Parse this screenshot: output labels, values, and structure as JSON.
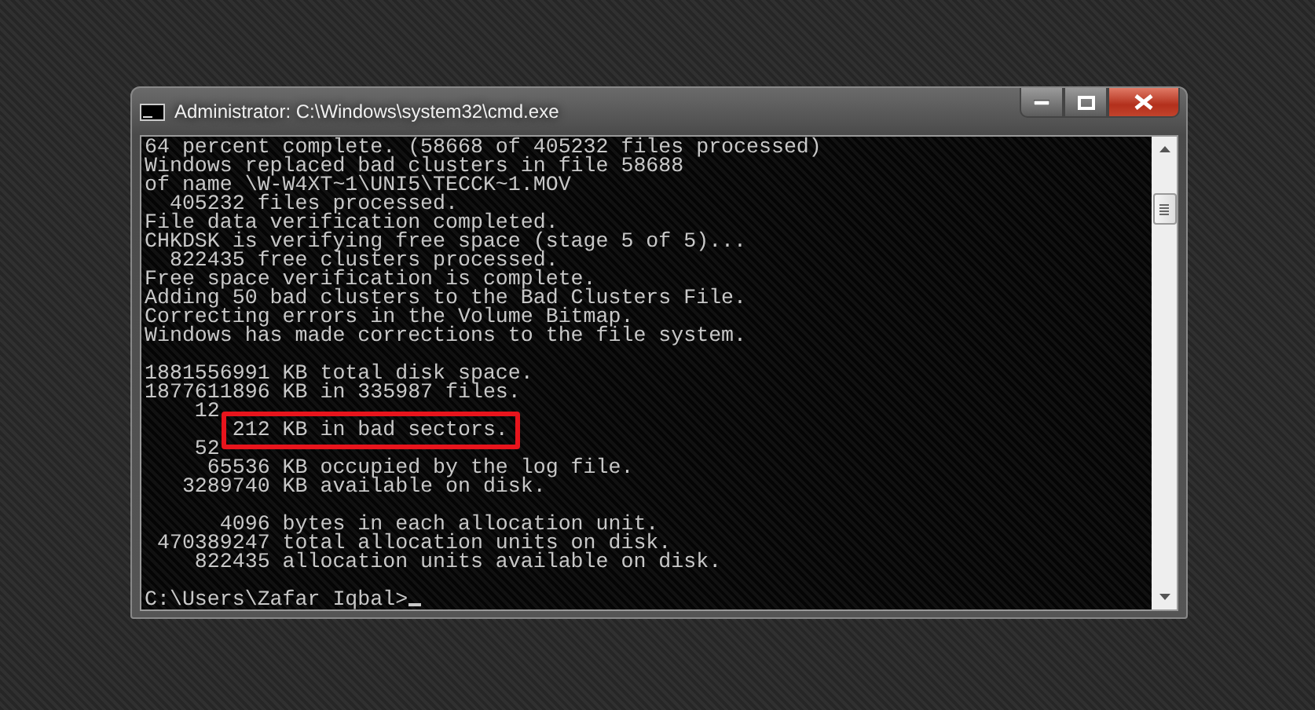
{
  "window": {
    "title": "Administrator: C:\\Windows\\system32\\cmd.exe"
  },
  "console": {
    "blocks": [
      [
        "64 percent complete. (58668 of 405232 files processed)",
        "Windows replaced bad clusters in file 58688",
        "of name \\W-W4XT~1\\UNI5\\TECCK~1.MOV",
        "  405232 files processed.",
        "File data verification completed.",
        "CHKDSK is verifying free space (stage 5 of 5)...",
        "  822435 free clusters processed.",
        "Free space verification is complete.",
        "Adding 50 bad clusters to the Bad Clusters File.",
        "Correcting errors in the Volume Bitmap.",
        "Windows has made corrections to the file system."
      ],
      [
        "1881556991 KB total disk space.",
        "1877611896 KB in 335987 files.",
        "    12",
        "       212 KB in bad sectors.",
        "    52",
        "     65536 KB occupied by the log file.",
        "   3289740 KB available on disk."
      ],
      [
        "      4096 bytes in each allocation unit.",
        " 470389247 total allocation units on disk.",
        "    822435 allocation units available on disk."
      ]
    ],
    "prompt": "C:\\Users\\Zafar Iqbal>"
  }
}
